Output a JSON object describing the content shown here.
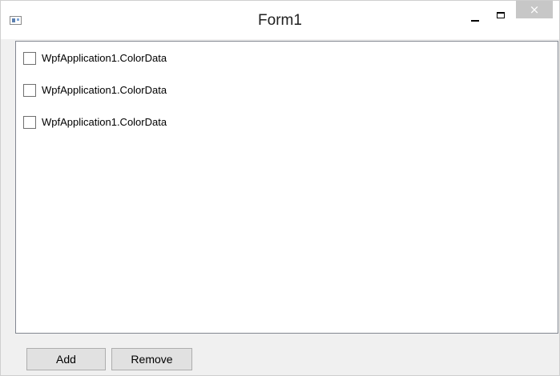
{
  "window": {
    "title": "Form1",
    "close_glyph": "×"
  },
  "listbox": {
    "items": [
      {
        "label": "WpfApplication1.ColorData",
        "checked": false
      },
      {
        "label": "WpfApplication1.ColorData",
        "checked": false
      },
      {
        "label": "WpfApplication1.ColorData",
        "checked": false
      }
    ]
  },
  "buttons": {
    "add_label": "Add",
    "remove_label": "Remove"
  },
  "icons": {
    "app": "app-window-icon",
    "minimize": "minimize-icon",
    "maximize": "maximize-icon",
    "close": "close-icon"
  },
  "colors": {
    "close_button_bg": "#c7c7c7",
    "window_bg": "#f0f0f0",
    "list_border": "#828790"
  }
}
